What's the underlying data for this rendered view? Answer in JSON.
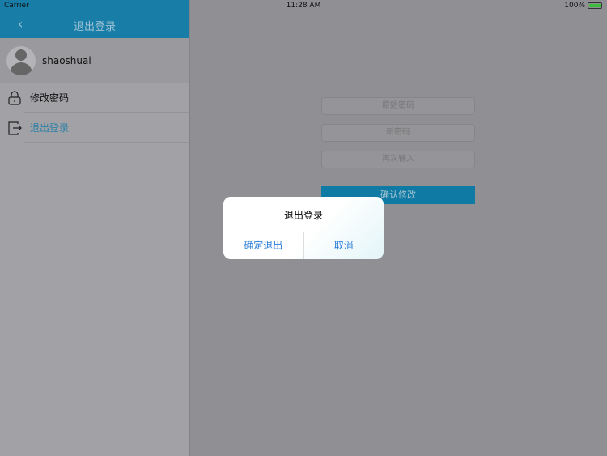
{
  "status": {
    "carrier": "Carrier",
    "time": "11:28 AM",
    "battery": "100%"
  },
  "sidebar": {
    "title": "退出登录",
    "username": "shaoshuai",
    "items": [
      {
        "label": "修改密码"
      },
      {
        "label": "退出登录"
      }
    ]
  },
  "form": {
    "old_placeholder": "原始密码",
    "new_placeholder": "新密码",
    "repeat_placeholder": "再次输入",
    "confirm_label": "确认修改"
  },
  "alert": {
    "title": "退出登录",
    "confirm": "确定退出",
    "cancel": "取消"
  }
}
